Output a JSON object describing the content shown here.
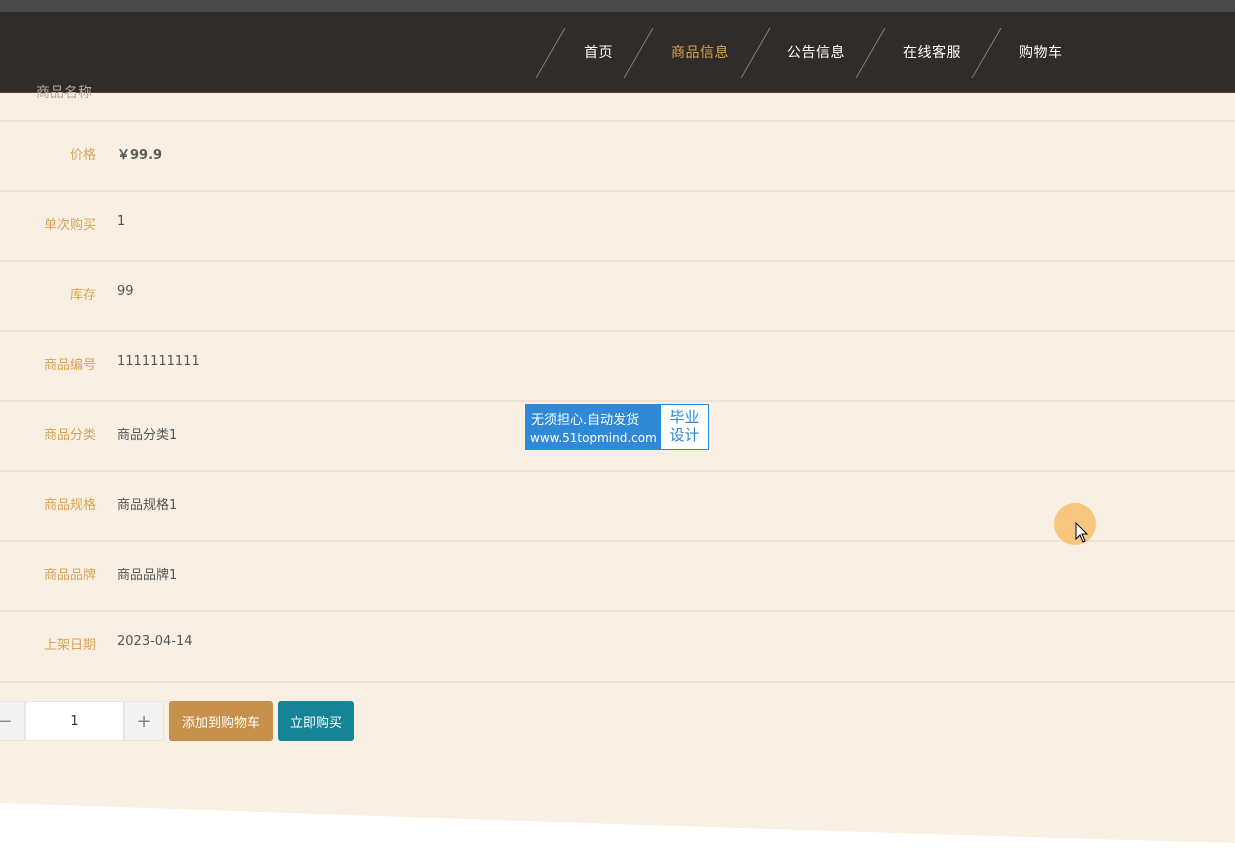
{
  "nav": {
    "items": [
      {
        "label": "首页"
      },
      {
        "label": "商品信息"
      },
      {
        "label": "公告信息"
      },
      {
        "label": "在线客服"
      },
      {
        "label": "购物车"
      }
    ],
    "active_index": 1
  },
  "product": {
    "clipped_label": "商品名称",
    "fields": [
      {
        "label": "价格",
        "value": "￥99.9"
      },
      {
        "label": "单次购买",
        "value": "1"
      },
      {
        "label": "库存",
        "value": "99"
      },
      {
        "label": "商品编号",
        "value": "1111111111"
      },
      {
        "label": "商品分类",
        "value": "商品分类1"
      },
      {
        "label": "商品规格",
        "value": "商品规格1"
      },
      {
        "label": "商品品牌",
        "value": "商品品牌1"
      },
      {
        "label": "上架日期",
        "value": "2023-04-14"
      }
    ]
  },
  "actions": {
    "quantity": "1",
    "minus": "−",
    "plus": "+",
    "add_to_cart": "添加到购物车",
    "buy_now": "立即购买"
  },
  "watermark": {
    "line1": "无须担心.自动发货",
    "line2": "www.51topmind.com",
    "badge_line1": "毕业",
    "badge_line2": "设计"
  },
  "colors": {
    "navbar_bg": "#2f2c29",
    "page_bg": "#f9efe3",
    "label_color": "#d7a456",
    "nav_active": "#e0a14a",
    "add_to_cart_bg": "#c8914b",
    "buy_now_bg": "#178396"
  }
}
